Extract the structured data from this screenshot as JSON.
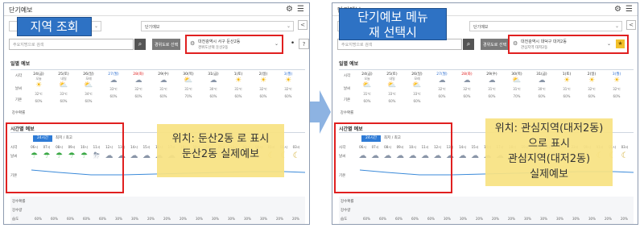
{
  "arrow_color": "#8db3e2",
  "left": {
    "app_title": "단기예보",
    "overlay_label": "지역 조회",
    "selector_region": "",
    "selector_type": "단기예보",
    "search_placeholder": "주요지명으로 검색",
    "location_button": "경위도로 선택",
    "location_line1": "대전광역시 서구 둔산2동",
    "location_line2": "경위도선택 둔산2동",
    "daily_label": "일별 예보",
    "hourly_label": "시간별 예보",
    "hourly_tab": "24시간",
    "hourly_range": "최저 / 최고",
    "annotation_line1": "위치: 둔산2동 로 표시",
    "annotation_line2": "둔산2동 실제예보",
    "day_heads": [
      "24(금)",
      "25(토)",
      "26(일)",
      "27(월)",
      "28(화)",
      "29(수)",
      "30(목)",
      "31(금)",
      "1(토)",
      "2(일)",
      "3(월)"
    ],
    "day_subs": [
      "오늘",
      "내일",
      "모레",
      "",
      "",
      "",
      "",
      "",
      "",
      "",
      ""
    ],
    "day_icons": [
      "☀",
      "⛅",
      "⛅",
      "☁",
      "☁",
      "☁",
      "⛅",
      "☁",
      "☀",
      "☀",
      "☀"
    ],
    "day_temps": [
      "32℃",
      "33℃",
      "34℃",
      "33℃",
      "32℃",
      "31℃",
      "31℃",
      "30℃",
      "31℃",
      "32℃",
      "32℃"
    ],
    "rain_probs": [
      "60%",
      "60%",
      "60%",
      "60%",
      "60%",
      "60%",
      "70%",
      "60%",
      "60%",
      "60%",
      "60%"
    ],
    "hour_times": [
      "06시",
      "07시",
      "08시",
      "09시",
      "10시",
      "11시",
      "12시",
      "13시",
      "14시",
      "15시",
      "16시",
      "17시",
      "18시",
      "19시",
      "20시",
      "21시",
      "22시",
      "23시",
      "00시",
      "01시",
      "02시",
      "03시"
    ],
    "hour_icons": [
      "☂",
      "☂",
      "☂",
      "☂",
      "☂",
      "⛈",
      "☁",
      "☁",
      "☁",
      "☁",
      "☁",
      "☁",
      "☁",
      "☁",
      "☾",
      "☾",
      "☾",
      "☾",
      "☾",
      "☾",
      "☾",
      "☾"
    ],
    "row_labels": [
      "시각",
      "날씨",
      "기온",
      "강수확률",
      "강수량",
      "습도"
    ],
    "bottom_values": [
      "60%",
      "60%",
      "60%",
      "60%",
      "60%",
      "30%",
      "30%",
      "20%",
      "20%",
      "20%",
      "30%",
      "30%",
      "30%",
      "30%",
      "30%",
      "20%",
      "20%"
    ]
  },
  "right": {
    "app_title": "단기예보",
    "overlay_label_line1": "단기예보 메뉴",
    "overlay_label_line2": "재 선택시",
    "selector_region": "",
    "selector_type": "단기예보",
    "search_placeholder": "주요지명으로 검색",
    "location_button": "경위도로 선택",
    "location_line1": "대전광역시 대덕구 대저2동",
    "location_line2": "관심지역 대저2동",
    "daily_label": "일별 예보",
    "hourly_label": "시간별 예보",
    "hourly_tab": "24시간",
    "hourly_range": "최저 / 최고",
    "annotation_line1": "위치: 관심지역(대저2동)",
    "annotation_line2": "으로 표시",
    "annotation_line3": "관심지역(대저2동)",
    "annotation_line4": "실제예보",
    "day_heads": [
      "24(금)",
      "25(토)",
      "26(일)",
      "27(월)",
      "28(화)",
      "29(수)",
      "30(목)",
      "31(금)",
      "1(토)",
      "2(일)",
      "3(월)"
    ],
    "day_subs": [
      "오늘",
      "내일",
      "모레",
      "",
      "",
      "",
      "",
      "",
      "",
      "",
      ""
    ],
    "day_icons": [
      "⛅",
      "⛅",
      "⛅",
      "☁",
      "☁",
      "☁",
      "⛅",
      "☁",
      "☀",
      "☀",
      "☀"
    ],
    "day_temps": [
      "31℃",
      "33℃",
      "33℃",
      "32℃",
      "32℃",
      "31℃",
      "31℃",
      "30℃",
      "31℃",
      "32℃",
      "32℃"
    ],
    "rain_probs": [
      "60%",
      "60%",
      "60%",
      "60%",
      "60%",
      "60%",
      "70%",
      "60%",
      "60%",
      "60%",
      "60%"
    ],
    "hour_times": [
      "06시",
      "07시",
      "08시",
      "09시",
      "10시",
      "11시",
      "12시",
      "13시",
      "14시",
      "15시",
      "16시",
      "17시",
      "18시",
      "19시",
      "20시",
      "21시",
      "22시",
      "23시",
      "00시",
      "01시",
      "02시",
      "03시"
    ],
    "hour_icons": [
      "☁",
      "☁",
      "☁",
      "☁",
      "☁",
      "☁",
      "☁",
      "☁",
      "☁",
      "☁",
      "☁",
      "☁",
      "☁",
      "☁",
      "☾",
      "☾",
      "☾",
      "☾",
      "☾",
      "☾",
      "☾",
      "☾"
    ],
    "row_labels": [
      "시각",
      "날씨",
      "기온",
      "강수확률",
      "강수량",
      "습도"
    ],
    "bottom_values": [
      "60%",
      "60%",
      "60%",
      "60%",
      "60%",
      "30%",
      "30%",
      "20%",
      "20%",
      "20%",
      "30%",
      "30%",
      "30%",
      "30%",
      "30%",
      "20%",
      "20%"
    ]
  }
}
